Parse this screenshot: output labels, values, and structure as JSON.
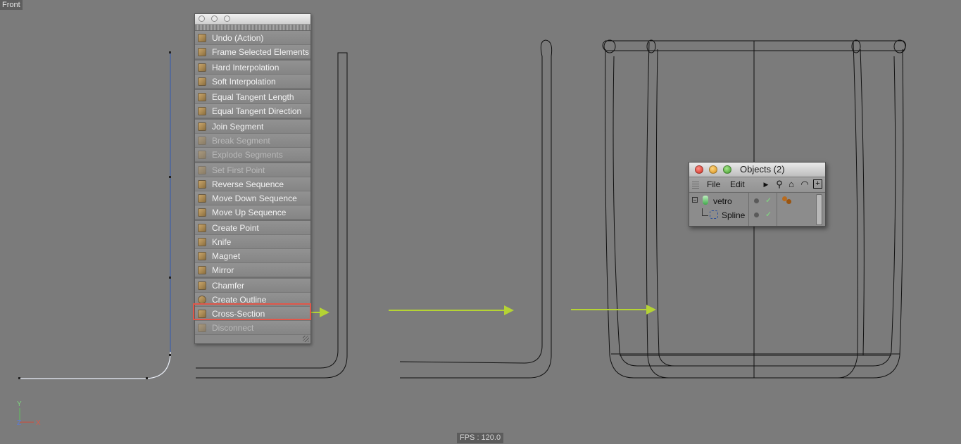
{
  "viewport": {
    "label": "Front"
  },
  "fps": "FPS : 120.0",
  "axis": {
    "y": "Y",
    "z": "Z",
    "x": "X"
  },
  "palette": {
    "groups": [
      [
        {
          "label": "Undo (Action)",
          "icon": "undo-icon",
          "disabled": false
        },
        {
          "label": "Frame Selected Elements",
          "icon": "frame-icon",
          "disabled": false
        }
      ],
      [
        {
          "label": "Hard Interpolation",
          "icon": "hard-interpolation-icon",
          "disabled": false
        },
        {
          "label": "Soft Interpolation",
          "icon": "soft-interpolation-icon",
          "disabled": false
        }
      ],
      [
        {
          "label": "Equal Tangent Length",
          "icon": "tangent-length-icon",
          "disabled": false
        },
        {
          "label": "Equal Tangent Direction",
          "icon": "tangent-direction-icon",
          "disabled": false
        }
      ],
      [
        {
          "label": "Join Segment",
          "icon": "join-segment-icon",
          "disabled": false
        },
        {
          "label": "Break Segment",
          "icon": "break-segment-icon",
          "disabled": true
        },
        {
          "label": "Explode Segments",
          "icon": "explode-segments-icon",
          "disabled": true
        }
      ],
      [
        {
          "label": "Set First Point",
          "icon": "first-point-icon",
          "disabled": true
        },
        {
          "label": "Reverse Sequence",
          "icon": "reverse-sequence-icon",
          "disabled": false
        },
        {
          "label": "Move Down Sequence",
          "icon": "move-down-icon",
          "disabled": false
        },
        {
          "label": "Move Up Sequence",
          "icon": "move-up-icon",
          "disabled": false
        }
      ],
      [
        {
          "label": "Create Point",
          "icon": "create-point-icon",
          "disabled": false
        },
        {
          "label": "Knife",
          "icon": "knife-icon",
          "disabled": false
        },
        {
          "label": "Magnet",
          "icon": "magnet-icon",
          "disabled": false
        },
        {
          "label": "Mirror",
          "icon": "mirror-icon",
          "disabled": false
        }
      ],
      [
        {
          "label": "Chamfer",
          "icon": "chamfer-icon",
          "disabled": false
        },
        {
          "label": "Create Outline",
          "icon": "create-outline-icon",
          "disabled": false
        },
        {
          "label": "Cross-Section",
          "icon": "cross-section-icon",
          "disabled": false
        },
        {
          "label": "Disconnect",
          "icon": "disconnect-icon",
          "disabled": true
        }
      ]
    ]
  },
  "objects": {
    "title": "Objects (2)",
    "menu": {
      "file": "File",
      "edit": "Edit"
    },
    "rows": [
      {
        "name": "vetro",
        "icon": "lathe-icon"
      },
      {
        "name": "Spline",
        "icon": "spline-icon"
      }
    ]
  },
  "colors": {
    "arrow": "#b5d334",
    "highlight": "#e0574a",
    "spline_selected": "#4a6fb5"
  }
}
